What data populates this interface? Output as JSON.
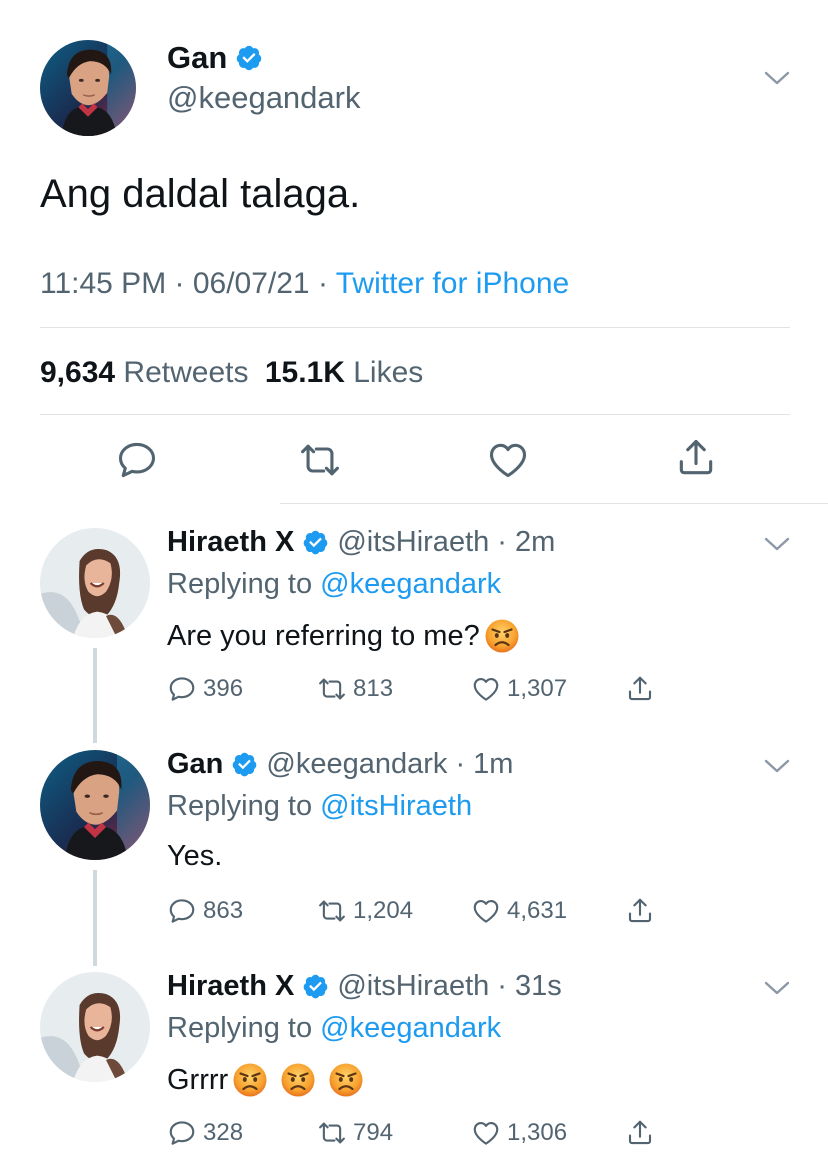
{
  "main": {
    "name": "Gan",
    "handle": "@keegandark",
    "text": "Ang daldal talaga.",
    "time": "11:45 PM · 06/07/21 · ",
    "source": "Twitter for iPhone",
    "retweets_count": "9,634",
    "retweets_label": "Retweets",
    "likes_count": "15.1K",
    "likes_label": "Likes",
    "icons": [
      "reply-icon",
      "retweet-icon",
      "like-icon",
      "share-icon"
    ]
  },
  "replies": [
    {
      "name": "Hiraeth X",
      "handle": "@itsHiraeth · 2m",
      "replying_prefix": "Replying to ",
      "replying_to": "@keegandark",
      "text": "Are you referring to me?",
      "emojis": [
        "angry-face-emoji"
      ],
      "reply_count": "396",
      "retweet_count": "813",
      "like_count": "1,307"
    },
    {
      "name": "Gan",
      "handle": "@keegandark · 1m",
      "replying_prefix": "Replying to ",
      "replying_to": "@itsHiraeth",
      "text": "Yes.",
      "emojis": [],
      "reply_count": "863",
      "retweet_count": "1,204",
      "like_count": "4,631"
    },
    {
      "name": "Hiraeth X",
      "handle": "@itsHiraeth · 31s",
      "replying_prefix": "Replying to ",
      "replying_to": "@keegandark",
      "text": "Grrrr",
      "emojis": [
        "angry-face-emoji",
        "angry-face-emoji",
        "angry-face-emoji"
      ],
      "reply_count": "328",
      "retweet_count": "794",
      "like_count": "1,306"
    }
  ],
  "colors": {
    "accent": "#1d9bf0",
    "secondary_text": "#536471",
    "primary_text": "#0f1419",
    "divider": "#dfe3e6",
    "thread_line": "#cfd9de"
  }
}
